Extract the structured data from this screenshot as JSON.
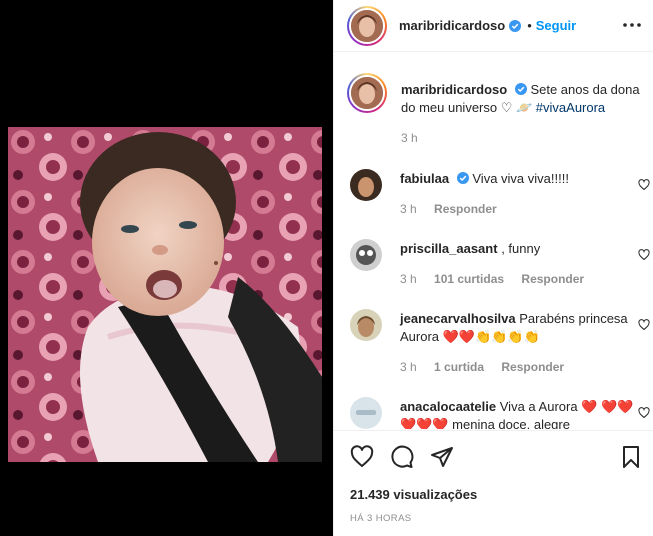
{
  "header": {
    "username": "maribridicardoso",
    "follow_label": "Seguir",
    "separator": "•"
  },
  "caption": {
    "username": "maribridicardoso",
    "text": "Sete anos da dona do meu universo ♡ 🪐 ",
    "hashtag": "#vivaAurora",
    "time": "3 h"
  },
  "comments": [
    {
      "username": "fabiulaa",
      "text": "Viva viva viva!!!!!",
      "time": "3 h",
      "likes": "",
      "reply_label": "Responder"
    },
    {
      "username": "priscilla_aasant",
      "text": ", funny",
      "time": "3 h",
      "likes": "101 curtidas",
      "reply_label": "Responder"
    },
    {
      "username": "jeanecarvalhosilva",
      "text": "Parabéns princesa Aurora ❤️❤️👏👏👏👏",
      "time": "3 h",
      "likes": "1 curtida",
      "reply_label": "Responder"
    },
    {
      "username": "anacalocaatelie",
      "text": "Viva a Aurora ❤️ ❤️❤️❤️❤️❤️ menina doce, alegre",
      "time": "",
      "likes": "",
      "reply_label": ""
    }
  ],
  "footer": {
    "views": "21.439 visualizações",
    "ago": "HÁ 3 HORAS"
  },
  "icons": {
    "like": "heart-icon",
    "comment": "comment-icon",
    "share": "share-icon",
    "save": "bookmark-icon",
    "more": "more-icon",
    "verified": "verified-badge-icon"
  },
  "colors": {
    "accent": "#0095f6",
    "muted": "#8e8e8e",
    "heart": "#e0162b"
  }
}
